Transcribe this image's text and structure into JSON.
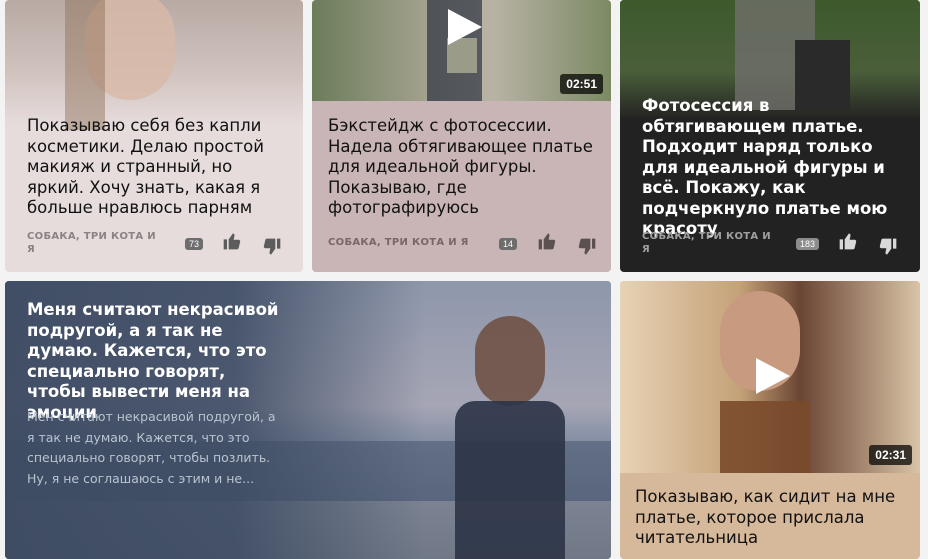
{
  "cards": [
    {
      "title": "Показываю себя без капли косметики. Делаю простой макияж и странный, но яркий. Хочу знать, какая я больше нравлюсь парням",
      "channel": "СОБАКА, ТРИ КОТА И Я",
      "comments": "73",
      "bg": "#e6dcdc"
    },
    {
      "title": "Бэкстейдж с фотосессии. Надела обтягивающее платье для идеальной фигуры. Показываю, где фотографируюсь",
      "channel": "СОБАКА, ТРИ КОТА И Я",
      "comments": "14",
      "duration": "02:51",
      "bg": "#c9b5b5"
    },
    {
      "title": "Фотосессия в обтягивающем платье. Подходит наряд только для идеальной фигуры и всё. Покажу, как подчеркнуло платье мою красоту",
      "channel": "СОБАКА, ТРИ КОТА И Я",
      "comments": "183",
      "bg": "#222222"
    },
    {
      "title": "Меня считают некрасивой подругой, а я так не думаю. Кажется, что это специально говорят, чтобы вывести меня на эмоции",
      "excerpt": "Мен считают некрасивой подругой, а я так не думаю. Кажется, что это специально говорят, чтобы позлить. Ну, я не соглашаюсь с этим и не...",
      "bg": "#56657a"
    },
    {
      "title": "Показываю, как сидит на мне платье, которое прислала читательница",
      "duration": "02:31",
      "bg": "#d6b89a"
    }
  ],
  "icons": {
    "like": "thumbs-up-icon",
    "dislike": "thumbs-down-icon",
    "play": "play-icon"
  }
}
